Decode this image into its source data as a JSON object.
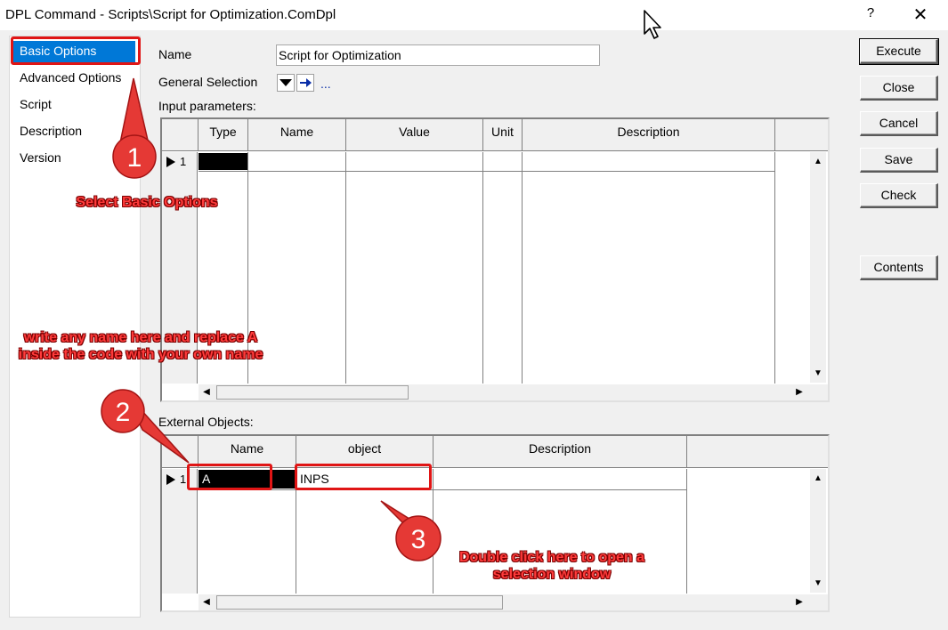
{
  "window": {
    "title": "DPL Command - Scripts\\Script for Optimization.ComDpl",
    "help_label": "?",
    "close_label": "✕"
  },
  "nav": {
    "items": [
      {
        "label": "Basic Options",
        "selected": true
      },
      {
        "label": "Advanced Options",
        "selected": false
      },
      {
        "label": "Script",
        "selected": false
      },
      {
        "label": "Description",
        "selected": false
      },
      {
        "label": "Version",
        "selected": false
      }
    ]
  },
  "form": {
    "name_label": "Name",
    "name_value": "Script for Optimization",
    "general_selection_label": "General Selection",
    "general_selection_more": "...",
    "input_params_label": "Input parameters:",
    "external_objects_label": "External Objects:"
  },
  "input_grid": {
    "columns": [
      "Type",
      "Name",
      "Value",
      "Unit",
      "Description"
    ],
    "rows": [
      {
        "num": "1",
        "type": "",
        "name": "",
        "value": "",
        "unit": "",
        "description": ""
      }
    ]
  },
  "external_grid": {
    "columns": [
      "Name",
      "object",
      "Description"
    ],
    "rows": [
      {
        "num": "1",
        "name": "A",
        "object": "INPS",
        "description": ""
      }
    ]
  },
  "buttons": {
    "execute": "Execute",
    "close": "Close",
    "cancel": "Cancel",
    "save": "Save",
    "check": "Check",
    "contents": "Contents"
  },
  "annotations": {
    "step1_number": "1",
    "step1_text": "Select Basic Options",
    "step2_number": "2",
    "step2_text": "write any name here and replace A inside the code with your own name",
    "step3_number": "3",
    "step3_text": "Double click here to open a selection window",
    "color": "#e01515"
  },
  "icons": {
    "row_pointer": "row-pointer-icon",
    "dropdown": "dropdown-arrow-icon",
    "jump": "jump-arrow-icon",
    "cursor": "mouse-cursor-icon"
  }
}
